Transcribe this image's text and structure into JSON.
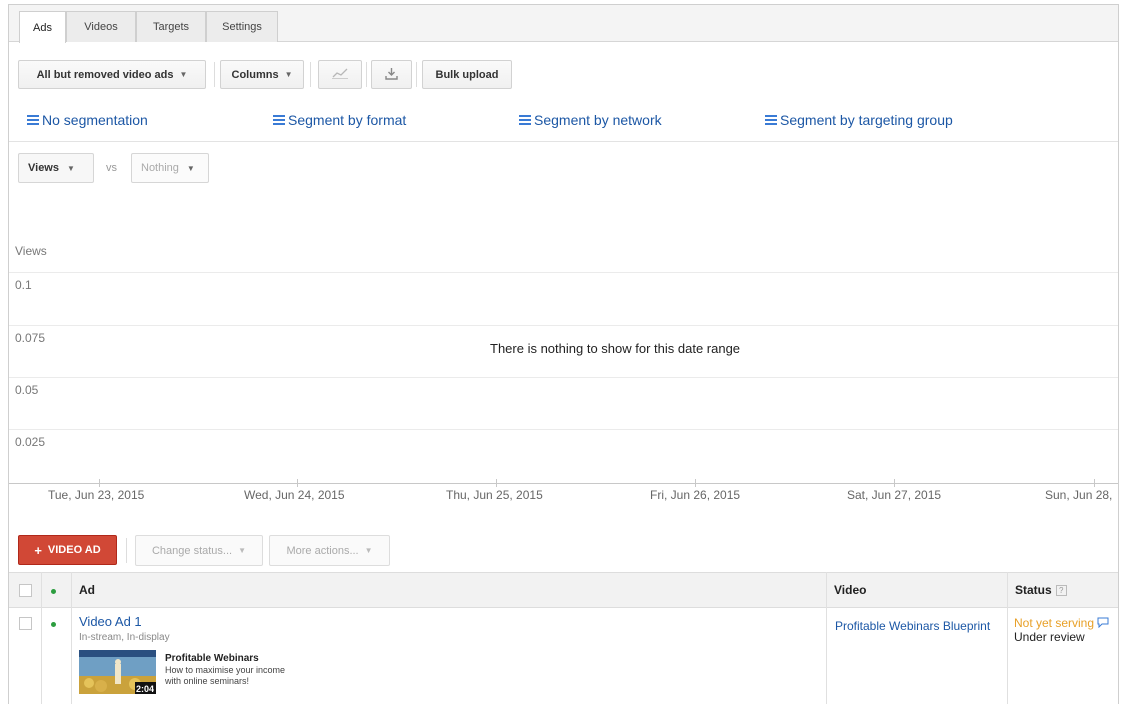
{
  "tabs": [
    {
      "label": "Ads",
      "active": true
    },
    {
      "label": "Videos",
      "active": false
    },
    {
      "label": "Targets",
      "active": false
    },
    {
      "label": "Settings",
      "active": false
    }
  ],
  "toolbar": {
    "filter_label": "All but removed video ads",
    "columns_label": "Columns",
    "chart_icon": "line-chart-icon",
    "download_icon": "download-icon",
    "bulk_upload_label": "Bulk upload"
  },
  "segmentation": [
    {
      "label": "No segmentation"
    },
    {
      "label": "Segment by format"
    },
    {
      "label": "Segment by network"
    },
    {
      "label": "Segment by targeting group"
    }
  ],
  "metric_selector": {
    "primary": "Views",
    "vs_label": "vs",
    "secondary": "Nothing"
  },
  "chart_data": {
    "type": "line",
    "ylabel": "Views",
    "y_ticks": [
      "0.1",
      "0.075",
      "0.05",
      "0.025"
    ],
    "x_ticks": [
      "Tue, Jun 23, 2015",
      "Wed, Jun 24, 2015",
      "Thu, Jun 25, 2015",
      "Fri, Jun 26, 2015",
      "Sat, Jun 27, 2015",
      "Sun, Jun 28,"
    ],
    "series": [],
    "empty_message": "There is nothing to show for this date range",
    "grid": true
  },
  "actions": {
    "add_label": "VIDEO AD",
    "change_status_label": "Change status...",
    "more_actions_label": "More actions..."
  },
  "table": {
    "headers": {
      "ad": "Ad",
      "video": "Video",
      "status": "Status",
      "status_help": "?"
    },
    "rows": [
      {
        "ad_name": "Video Ad 1",
        "ad_formats": "In-stream, In-display",
        "thumb_duration": "2:04",
        "promo_title": "Profitable Webinars",
        "promo_line1": "How to maximise your income",
        "promo_line2": "with online seminars!",
        "video": "Profitable Webinars Blueprint",
        "status_primary": "Not yet serving",
        "status_secondary": "Under review"
      }
    ]
  },
  "colors": {
    "link": "#1c57a5",
    "add_button": "#d14836",
    "status_warning": "#e8a027",
    "enabled_dot": "#2c9d3f"
  }
}
